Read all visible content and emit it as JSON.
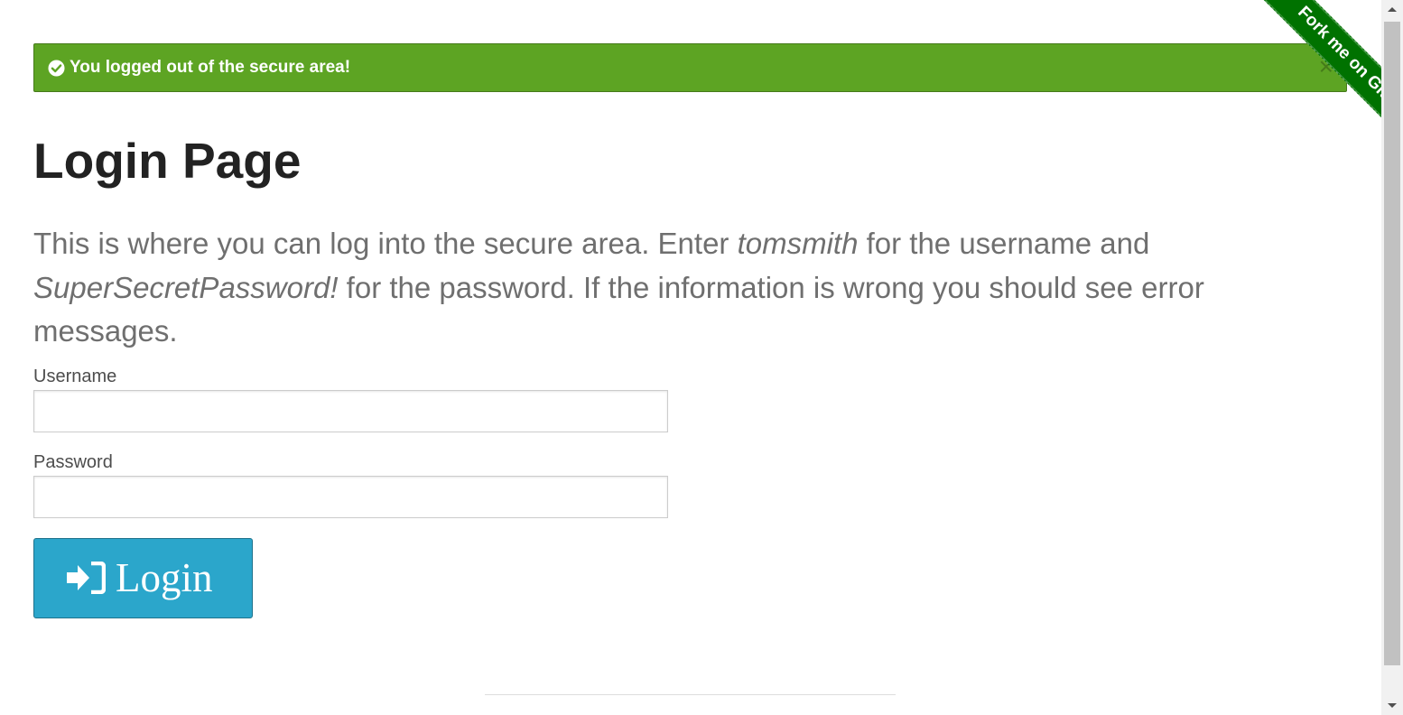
{
  "flash": {
    "message": "You logged out of the secure area!",
    "close_symbol": "×",
    "icon": "check-circle-icon",
    "color": "#5da423"
  },
  "page": {
    "title": "Login Page",
    "intro_prefix": "This is where you can log into the secure area. Enter ",
    "username_hint": "tomsmith",
    "intro_middle": " for the username and ",
    "password_hint": "SuperSecretPassword!",
    "intro_suffix": " for the password. If the information is wrong you should see error messages."
  },
  "form": {
    "username_label": "Username",
    "username_value": "",
    "password_label": "Password",
    "password_value": "",
    "login_label": "Login",
    "login_icon": "sign-in-icon",
    "button_color": "#2ba6cb"
  },
  "ribbon": {
    "text": "Fork me on GitHub",
    "color": "#007200"
  }
}
